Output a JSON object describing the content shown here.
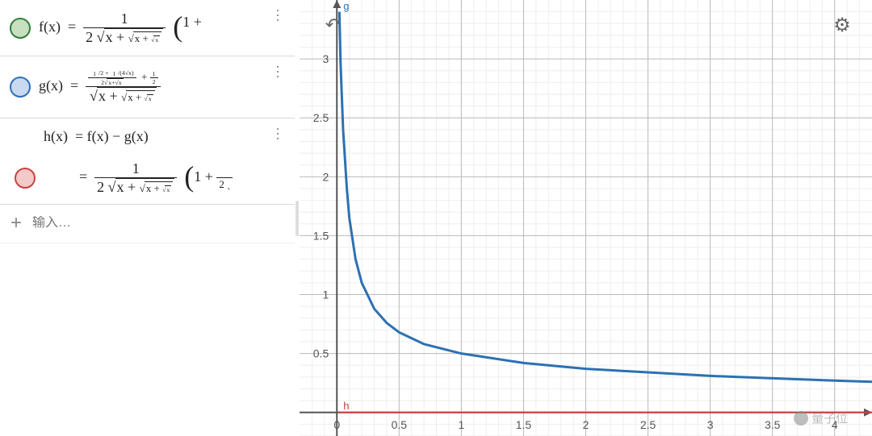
{
  "sidebar": {
    "expressions": [
      {
        "color": "green",
        "lhs": "f(x)",
        "label": "expression-f"
      },
      {
        "color": "blue",
        "lhs": "g(x)",
        "label": "expression-g"
      },
      {
        "color": "red",
        "lhs": "h(x)",
        "rhs_simple": "f(x) − g(x)",
        "label": "expression-h"
      }
    ],
    "input_placeholder": "输入…",
    "add_symbol": "+"
  },
  "toolbar": {
    "undo_glyph": "↶",
    "settings_glyph": "⚙"
  },
  "graph": {
    "function_labels": {
      "g": "g",
      "h": "h"
    },
    "watermark": "量子位"
  },
  "chart_data": {
    "type": "line",
    "title": "",
    "xlabel": "",
    "ylabel": "",
    "xlim": [
      -0.3,
      4.3
    ],
    "ylim": [
      -0.2,
      3.5
    ],
    "x_ticks": [
      0,
      0.5,
      1,
      1.5,
      2,
      2.5,
      3,
      3.5,
      4
    ],
    "y_ticks": [
      0.5,
      1,
      1.5,
      2,
      2.5,
      3
    ],
    "minor_step": 0.1,
    "series": [
      {
        "name": "g",
        "color": "#2d70b3",
        "x": [
          0.02,
          0.03,
          0.05,
          0.08,
          0.1,
          0.15,
          0.2,
          0.3,
          0.4,
          0.5,
          0.7,
          1.0,
          1.5,
          2.0,
          2.5,
          3.0,
          3.5,
          4.0,
          4.3
        ],
        "y": [
          3.4,
          2.95,
          2.4,
          1.9,
          1.65,
          1.3,
          1.1,
          0.88,
          0.76,
          0.68,
          0.58,
          0.5,
          0.42,
          0.37,
          0.34,
          0.31,
          0.29,
          0.27,
          0.26
        ]
      },
      {
        "name": "h",
        "color": "#c74440",
        "x": [
          0.01,
          4.3
        ],
        "y": [
          0.0,
          0.0
        ]
      }
    ]
  }
}
